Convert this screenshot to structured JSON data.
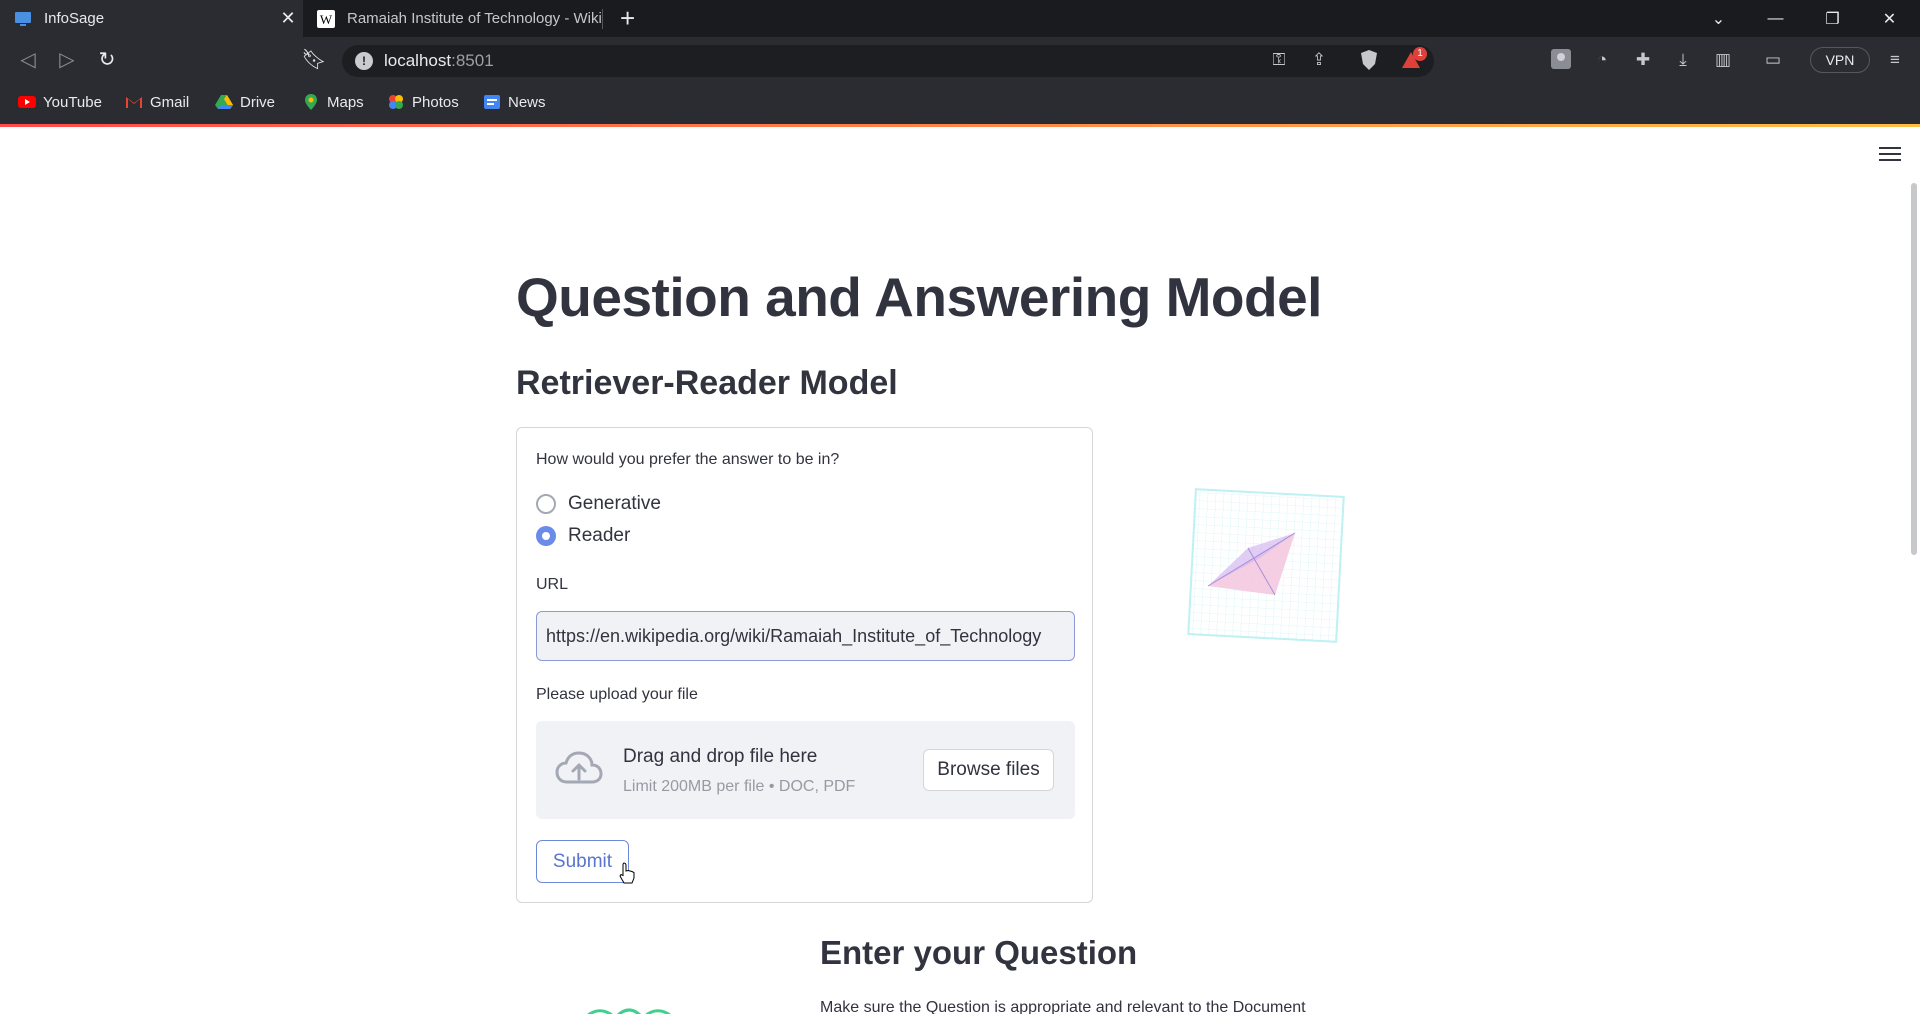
{
  "browser": {
    "tabs": [
      {
        "title": "InfoSage",
        "active": true
      },
      {
        "title": "Ramaiah Institute of Technology - Wiki",
        "active": false
      }
    ],
    "address": {
      "host": "localhost",
      "port": ":8501"
    },
    "vpn_label": "VPN",
    "badge_count": "1",
    "bookmarks": [
      "YouTube",
      "Gmail",
      "Drive",
      "Maps",
      "Photos",
      "News"
    ]
  },
  "page": {
    "title": "Question and Answering Model",
    "subtitle": "Retriever-Reader Model",
    "form": {
      "question": "How would you prefer the answer to be in?",
      "options": [
        "Generative",
        "Reader"
      ],
      "selected_option": "Reader",
      "url_label": "URL",
      "url_value": "https://en.wikipedia.org/wiki/Ramaiah_Institute_of_Technology",
      "upload_label": "Please upload your file",
      "dropzone_title": "Drag and drop file here",
      "dropzone_limit": "Limit 200MB per file • DOC, PDF",
      "browse_label": "Browse files",
      "submit_label": "Submit"
    },
    "question_section": {
      "heading": "Enter your Question",
      "hint": "Make sure the Question is appropriate and relevant to the Document"
    }
  },
  "colors": {
    "accent": "#ff4b4b",
    "radio": "#6a8ce8",
    "text": "#31333f"
  }
}
